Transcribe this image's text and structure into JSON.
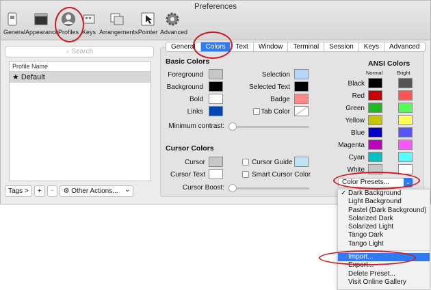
{
  "window": {
    "title": "Preferences"
  },
  "toolbar": {
    "items": [
      {
        "label": "General",
        "icon": "switch-icon"
      },
      {
        "label": "Appearance",
        "icon": "appearance-icon"
      },
      {
        "label": "Profiles",
        "icon": "profile-icon"
      },
      {
        "label": "Keys",
        "icon": "keyboard-icon"
      },
      {
        "label": "Arrangements",
        "icon": "windows-icon"
      },
      {
        "label": "Pointer",
        "icon": "pointer-icon"
      },
      {
        "label": "Advanced",
        "icon": "gear-icon"
      }
    ],
    "selected": "Profiles"
  },
  "profiles": {
    "search_placeholder": "Search",
    "column_header": "Profile Name",
    "items": [
      "★ Default"
    ],
    "tags_label": "Tags >",
    "add_label": "+",
    "remove_label": "−",
    "other_actions_label": "Other Actions...",
    "other_actions_caret": "⌄"
  },
  "tabs": [
    "General",
    "Colors",
    "Text",
    "Window",
    "Terminal",
    "Session",
    "Keys",
    "Advanced"
  ],
  "active_tab": "Colors",
  "basic": {
    "title": "Basic Colors",
    "foreground": "Foreground",
    "background": "Background",
    "bold": "Bold",
    "links": "Links",
    "selection": "Selection",
    "selected_text": "Selected Text",
    "badge": "Badge",
    "tab_color": "Tab Color",
    "min_contrast": "Minimum contrast:"
  },
  "cursor": {
    "title": "Cursor Colors",
    "cursor": "Cursor",
    "cursor_text": "Cursor Text",
    "cursor_guide": "Cursor Guide",
    "smart_cursor": "Smart Cursor Color",
    "boost": "Cursor Boost:"
  },
  "ansi": {
    "title": "ANSI Colors",
    "normal": "Normal",
    "bright": "Bright",
    "rows": [
      {
        "name": "Black",
        "normal": "#000000",
        "bright": "#555555"
      },
      {
        "name": "Red",
        "normal": "#c80000",
        "bright": "#ff5555"
      },
      {
        "name": "Green",
        "normal": "#22b822",
        "bright": "#55ff55"
      },
      {
        "name": "Yellow",
        "normal": "#c7c400",
        "bright": "#ffff55"
      },
      {
        "name": "Blue",
        "normal": "#0000c8",
        "bright": "#5555ff"
      },
      {
        "name": "Magenta",
        "normal": "#c000c0",
        "bright": "#ff55ff"
      },
      {
        "name": "Cyan",
        "normal": "#00c2c2",
        "bright": "#55ffff"
      },
      {
        "name": "White",
        "normal": "#c7c7c7",
        "bright": "#ffffff"
      }
    ]
  },
  "colors": {
    "foreground": "#c7c7c7",
    "background": "#000000",
    "bold": "#ffffff",
    "links": "#0645ad",
    "selection": "#b5d5ff",
    "selected_text": "#000000",
    "badge": "#ff8a8a",
    "cursor": "#c7c7c7",
    "cursor_text": "#ffffff",
    "accent": "#2f7bf5",
    "annotation": "#d0191f"
  },
  "presets": {
    "label": "Color Presets...",
    "menu": [
      "Dark Background",
      "Light Background",
      "Pastel (Dark Background)",
      "Solarized Dark",
      "Solarized Light",
      "Tango Dark",
      "Tango Light"
    ],
    "checked": "Dark Background",
    "actions": [
      "Import...",
      "Export...",
      "Delete Preset...",
      "Visit Online Gallery"
    ],
    "highlighted": "Import..."
  }
}
